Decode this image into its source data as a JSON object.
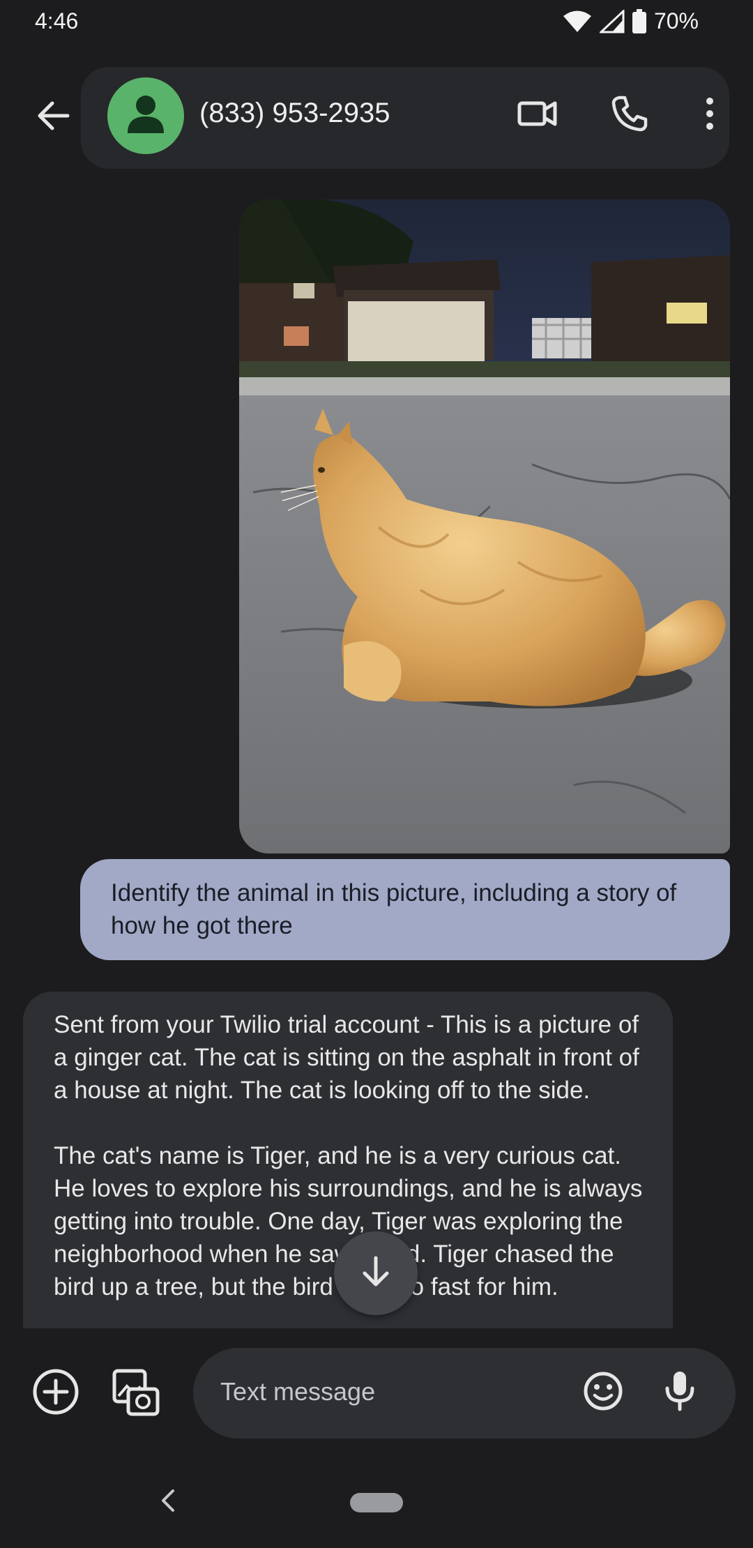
{
  "status_bar": {
    "time": "4:46",
    "battery_text": "70%",
    "icons": [
      "wifi-icon",
      "signal-icon",
      "battery-icon"
    ]
  },
  "header": {
    "contact_name": "(833) 953-2935",
    "icons": [
      "back-arrow-icon",
      "avatar-person-icon",
      "video-call-icon",
      "phone-icon",
      "more-vert-icon"
    ],
    "avatar_color": "#5ab36a"
  },
  "messages": {
    "outgoing_text": "Identify the animal in this picture, including a story of how he got there",
    "incoming_paragraphs": [
      "Sent from your Twilio trial account - This is a picture of a ginger cat. The cat is sitting on the asphalt in front of a house at night. The cat is looking off to the side.",
      "The cat's name is Tiger, and he is a very curious cat. He loves to explore his surroundings, and he is always getting into trouble. One day, Tiger was exploring the neighborhood when he saw a bird. Tiger chased the bird up a tree, but the bird was too fast for him."
    ]
  },
  "compose": {
    "placeholder": "Text message",
    "icons": [
      "add-circle-icon",
      "gallery-icon",
      "emoji-icon",
      "mic-icon"
    ]
  },
  "colors": {
    "background": "#1c1c1e",
    "outgoing_bubble": "#a1a9c7",
    "incoming_bubble": "#2e2f33",
    "header_pill": "#27282b"
  }
}
